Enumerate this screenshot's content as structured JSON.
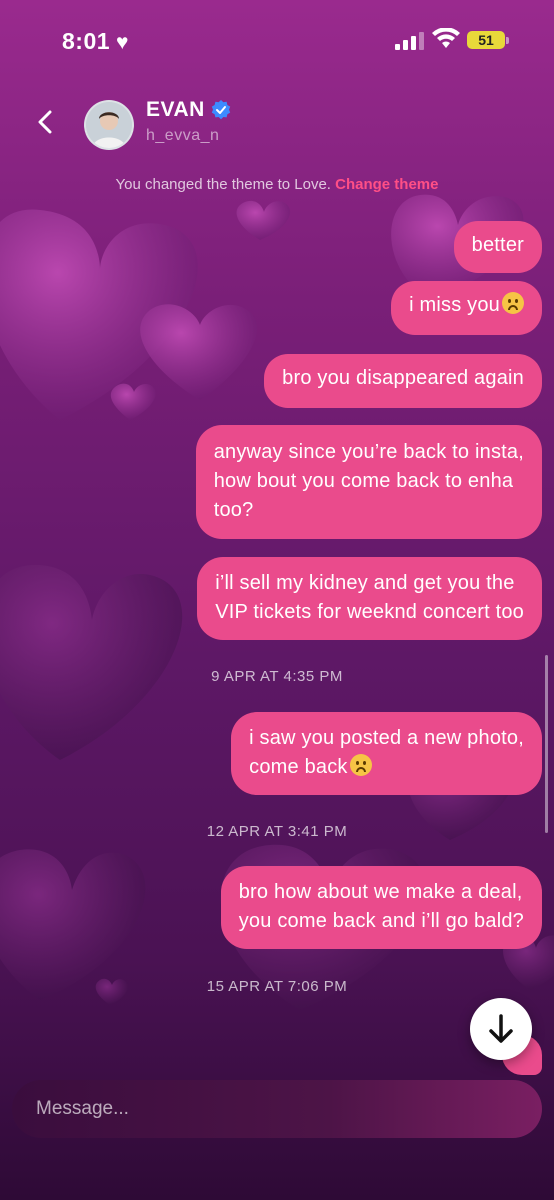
{
  "status": {
    "time": "8:01",
    "battery": "51"
  },
  "header": {
    "contact_name": "EVAN",
    "handle": "h_evva_n"
  },
  "system_note": {
    "text": "You changed the theme to Love.",
    "link": "Change theme"
  },
  "messages": [
    {
      "text": "better"
    },
    {
      "text": "i miss you"
    },
    {
      "text": "bro you disappeared again"
    },
    {
      "line1": "anyway since you’re back to insta,",
      "line2": "how bout you come back to enha",
      "line3": "too?"
    },
    {
      "line1": "i’ll sell my kidney and get you the",
      "line2": "VIP tickets for weeknd concert too"
    },
    {
      "line1": "i saw you posted a new photo,",
      "line2": "come back"
    },
    {
      "line1": "bro how about we make a deal,",
      "line2": "you come back and i’ll go bald?"
    }
  ],
  "timestamps": [
    "9 APR AT 4:35 PM",
    "12 APR AT 3:41 PM",
    "15 APR AT 7:06 PM"
  ],
  "composer": {
    "placeholder": "Message..."
  },
  "colors": {
    "bubble": "#ea4b8c",
    "link": "#ff4f86",
    "verified": "#3d8bff"
  }
}
